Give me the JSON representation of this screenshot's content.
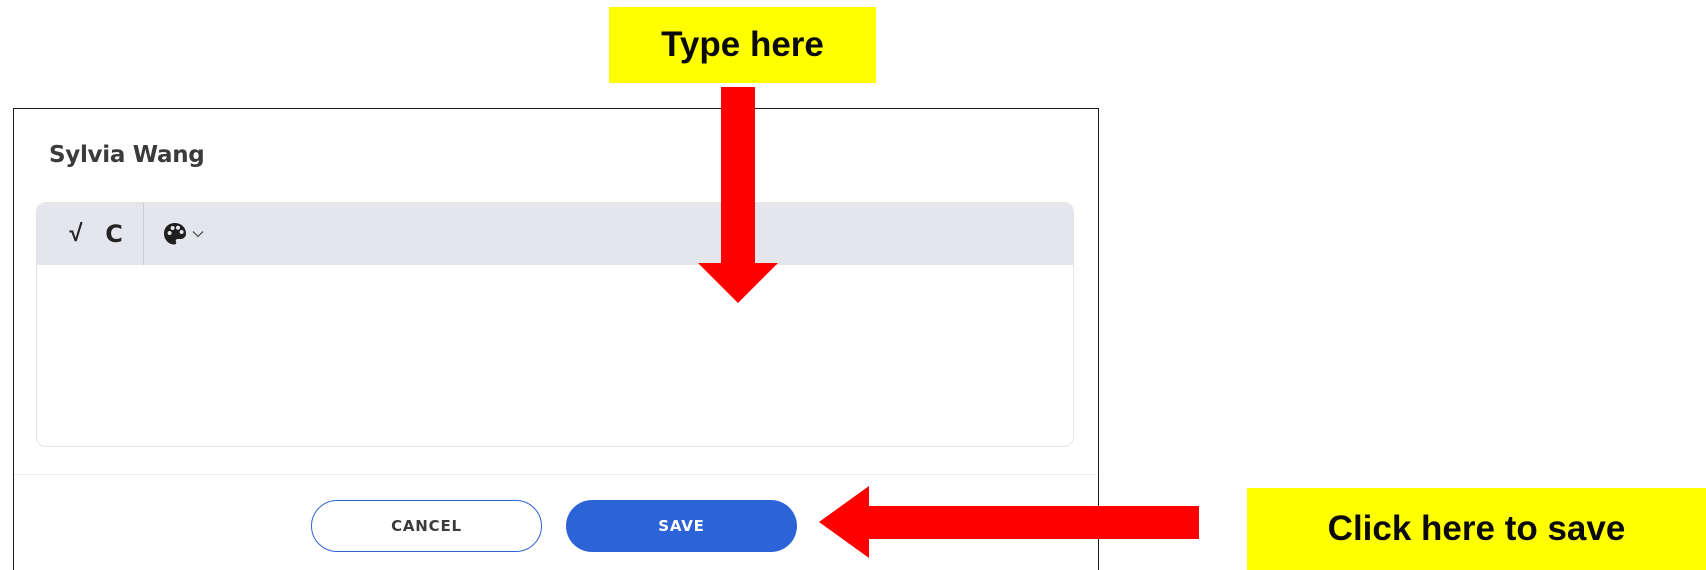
{
  "annotations": {
    "type_here": "Type here",
    "click_save": "Click here to save",
    "highlight_color": "#ffff00",
    "arrow_color": "#ff0000"
  },
  "dialog": {
    "title": "Sylvia Wang",
    "toolbar": {
      "items": [
        {
          "icon": "square-root-icon",
          "glyph": "√"
        },
        {
          "icon": "clear-format-icon",
          "glyph": "C"
        },
        {
          "icon": "palette-icon",
          "has_dropdown": true
        }
      ]
    },
    "editor": {
      "value": "",
      "placeholder": ""
    },
    "buttons": {
      "cancel_label": "CANCEL",
      "save_label": "SAVE"
    },
    "colors": {
      "primary": "#2c63d6",
      "toolbar_bg": "#e4e6ec"
    }
  }
}
